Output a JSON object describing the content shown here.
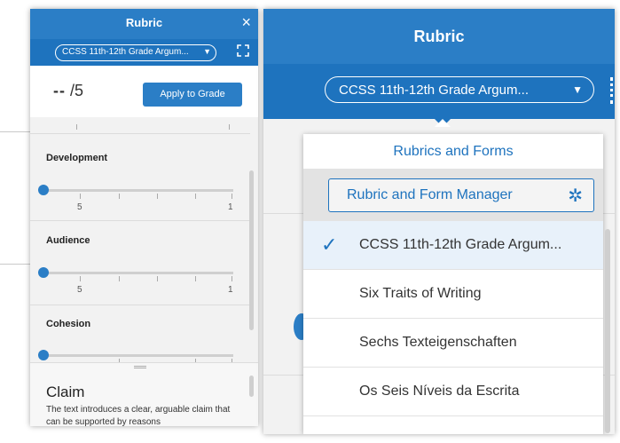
{
  "left_panel": {
    "title": "Rubric",
    "close_icon": "×",
    "rubric_select": "CCSS 11th-12th Grade Argum...",
    "score": {
      "dashes": "--",
      "out_of": "/5"
    },
    "apply_button": "Apply to Grade",
    "criteria": [
      {
        "label": "Development",
        "min": "5",
        "max": "1",
        "value": 5
      },
      {
        "label": "Audience",
        "min": "5",
        "max": "1",
        "value": 5
      },
      {
        "label": "Cohesion",
        "value": 5
      }
    ],
    "drawer": {
      "heading": "Claim",
      "text": "The text introduces a clear, arguable claim that can be supported by reasons"
    }
  },
  "right_panel": {
    "title": "Rubric",
    "rubric_select": "CCSS 11th-12th Grade Argum...",
    "dropdown": {
      "section_title": "Rubrics and Forms",
      "manager_button": "Rubric and Form Manager",
      "items": [
        {
          "label": "CCSS 11th-12th Grade Argum...",
          "selected": true
        },
        {
          "label": "Six Traits of Writing",
          "selected": false
        },
        {
          "label": "Sechs Texteigenschaften",
          "selected": false
        },
        {
          "label": "Os Seis Níveis da Escrita",
          "selected": false
        }
      ]
    }
  },
  "icons": {
    "close": "close-icon",
    "expand": "expand-icon",
    "caret": "chevron-down-icon",
    "gear": "gear-icon",
    "check": "checkmark-icon"
  },
  "colors": {
    "accent": "#2b7ec6",
    "accent_dark": "#1e73be",
    "panel_bg": "#f2f2f2"
  }
}
